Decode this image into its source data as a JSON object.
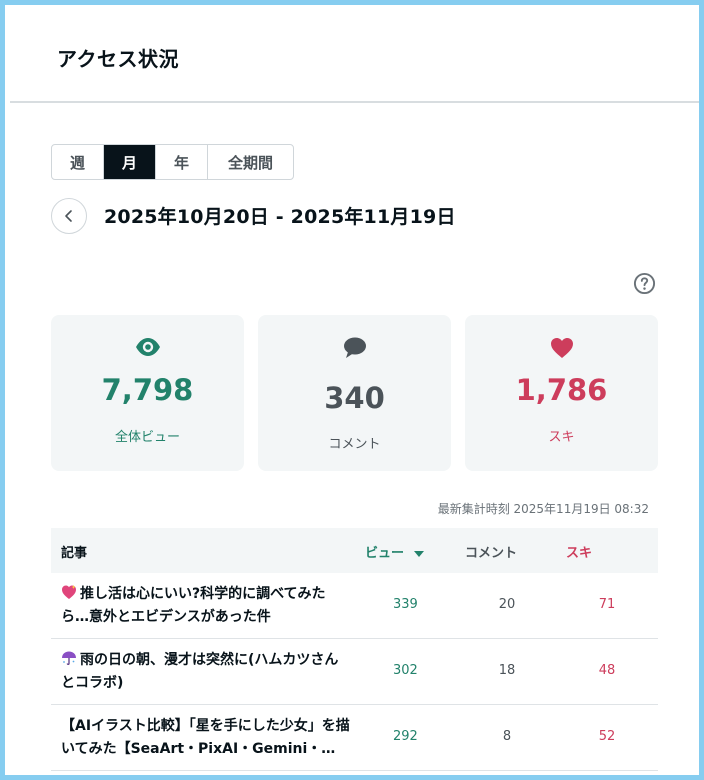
{
  "header": {
    "title": "アクセス状況"
  },
  "period_tabs": [
    {
      "label": "週",
      "active": false
    },
    {
      "label": "月",
      "active": true
    },
    {
      "label": "年",
      "active": false
    },
    {
      "label": "全期間",
      "active": false
    }
  ],
  "date_range": "2025年10月20日 - 2025年11月19日",
  "stats": {
    "views": {
      "value": "7,798",
      "label": "全体ビュー",
      "icon": "eye-icon",
      "color": "#22826b"
    },
    "comments": {
      "value": "340",
      "label": "コメント",
      "icon": "speech-bubble-icon",
      "color": "#4b5359"
    },
    "likes": {
      "value": "1,786",
      "label": "スキ",
      "icon": "heart-icon",
      "color": "#cd3d5c"
    }
  },
  "last_updated": "最新集計時刻 2025年11月19日 08:32",
  "table": {
    "headers": {
      "article": "記事",
      "views": "ビュー",
      "comments": "コメント",
      "likes": "スキ"
    },
    "sort_icon": "sort-desc-icon",
    "rows": [
      {
        "icon": "sparkling-heart-emoji",
        "title": "推し活は心にいい?科学的に調べてみたら…意外とエビデンスがあった件",
        "views": "339",
        "comments": "20",
        "likes": "71"
      },
      {
        "icon": "umbrella-emoji",
        "title": "雨の日の朝、漫才は突然に(ハムカツさんとコラボ)",
        "views": "302",
        "comments": "18",
        "likes": "48"
      },
      {
        "icon": "",
        "title": "【AIイラスト比較】「星を手にした少女」を描いてみた【SeaArt・PixAI・Gemini・…",
        "views": "292",
        "comments": "8",
        "likes": "52"
      }
    ]
  }
}
